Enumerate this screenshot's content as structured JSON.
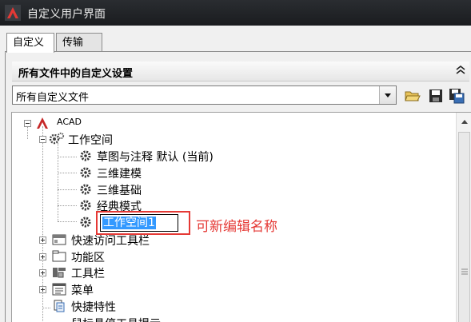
{
  "window": {
    "title": "自定义用户界面"
  },
  "tabs": [
    {
      "label": "自定义",
      "active": true
    },
    {
      "label": "传输",
      "active": false
    }
  ],
  "panel": {
    "section_title": "所有文件中的自定义设置",
    "file_selector": {
      "value": "所有自定义文件"
    },
    "tools": [
      "open-folder-icon",
      "save-icon",
      "save-as-icon"
    ]
  },
  "tree": {
    "root": "ACAD",
    "workspaces": {
      "label": "工作空间",
      "items": [
        "草图与注释 默认 (当前)",
        "三维建模",
        "三维基础",
        "经典模式"
      ],
      "editing": "工作空间1"
    },
    "nodes": [
      "快速访问工具栏",
      "功能区",
      "工具栏",
      "菜单",
      "快捷特性",
      "鼠标悬停工具提示"
    ]
  },
  "annotation": {
    "text": "可新编辑名称",
    "color": "#e53935"
  },
  "colors": {
    "titlebar": "#1f2226",
    "accent": "#c62828",
    "selection": "#3399ff"
  }
}
